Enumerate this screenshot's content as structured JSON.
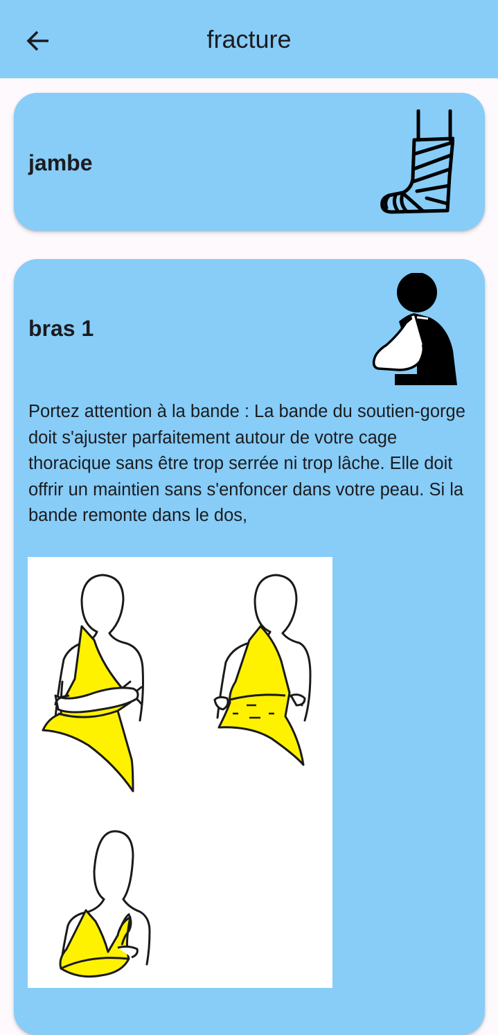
{
  "app_bar": {
    "title": "fracture",
    "back_icon": "arrow-left-icon"
  },
  "cards": [
    {
      "title": "jambe",
      "icon": "leg-cast-icon"
    },
    {
      "title": "bras 1",
      "icon": "arm-sling-person-icon",
      "text": "Portez attention à la bande : La bande du soutien-gorge doit s'ajuster parfaitement autour de votre cage thoracique sans être trop serrée ni trop lâche. Elle doit offrir un maintien sans s'enfoncer dans votre peau. Si la bande remonte dans le dos,",
      "image": "arm-sling-illustration"
    }
  ],
  "colors": {
    "app_bar": "#87cdf8",
    "card": "#87cdf8",
    "background": "#fdf9fd",
    "sling": "#fff200"
  }
}
